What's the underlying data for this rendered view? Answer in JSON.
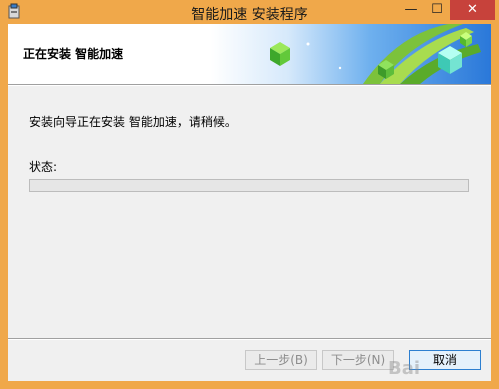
{
  "window": {
    "title": "智能加速 安装程序",
    "minimize_glyph": "—",
    "maximize_glyph": "☐",
    "close_glyph": "✕",
    "title_bar_color": "#f0a84a"
  },
  "banner": {
    "title": "正在安装 智能加速"
  },
  "main": {
    "description": "安装向导正在安装 智能加速，请稍候。",
    "status_label": "状态:",
    "progress_fraction": 0
  },
  "buttons": {
    "back_label": "上一步(B)",
    "next_label": "下一步(N)",
    "cancel_label": "取消"
  },
  "icons": {
    "app": "installer-icon",
    "banner_art": "green-cubes-art"
  },
  "watermark": {
    "text": "Bai"
  }
}
